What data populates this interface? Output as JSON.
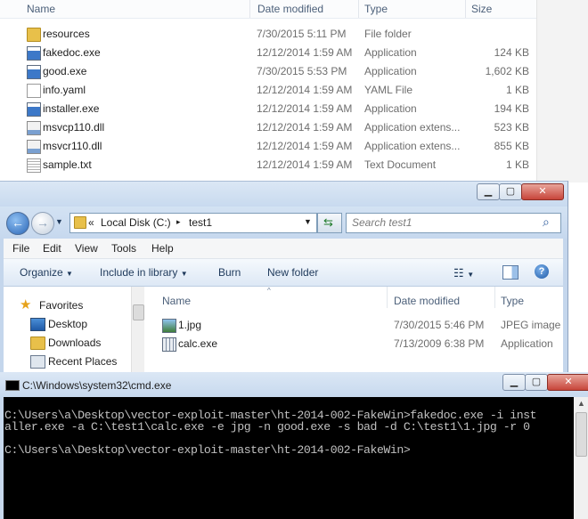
{
  "bg_explorer": {
    "columns": {
      "name": "Name",
      "date": "Date modified",
      "type": "Type",
      "size": "Size"
    },
    "rows": [
      {
        "name": "resources",
        "date": "7/30/2015 5:11 PM",
        "type": "File folder",
        "size": "",
        "icon": "folder-icon"
      },
      {
        "name": "fakedoc.exe",
        "date": "12/12/2014 1:59 AM",
        "type": "Application",
        "size": "124 KB",
        "icon": "exe-icon"
      },
      {
        "name": "good.exe",
        "date": "7/30/2015 5:53 PM",
        "type": "Application",
        "size": "1,602 KB",
        "icon": "exe-icon"
      },
      {
        "name": "info.yaml",
        "date": "12/12/2014 1:59 AM",
        "type": "YAML File",
        "size": "1 KB",
        "icon": "file-icon"
      },
      {
        "name": "installer.exe",
        "date": "12/12/2014 1:59 AM",
        "type": "Application",
        "size": "194 KB",
        "icon": "exe-icon"
      },
      {
        "name": "msvcp110.dll",
        "date": "12/12/2014 1:59 AM",
        "type": "Application extens...",
        "size": "523 KB",
        "icon": "dll-icon"
      },
      {
        "name": "msvcr110.dll",
        "date": "12/12/2014 1:59 AM",
        "type": "Application extens...",
        "size": "855 KB",
        "icon": "dll-icon"
      },
      {
        "name": "sample.txt",
        "date": "12/12/2014 1:59 AM",
        "type": "Text Document",
        "size": "1 KB",
        "icon": "text-file-icon"
      }
    ]
  },
  "fg_explorer": {
    "breadcrumb": {
      "prefix": "«",
      "drive": "Local Disk (C:)",
      "sep": "▸",
      "folder": "test1"
    },
    "search_placeholder": "Search test1",
    "menu": [
      "File",
      "Edit",
      "View",
      "Tools",
      "Help"
    ],
    "commands": {
      "organize": "Organize",
      "include": "Include in library",
      "burn": "Burn",
      "new_folder": "New folder"
    },
    "nav": [
      {
        "label": "Favorites",
        "icon": "star-icon"
      },
      {
        "label": "Desktop",
        "icon": "desktop-icon"
      },
      {
        "label": "Downloads",
        "icon": "downloads-folder-icon"
      },
      {
        "label": "Recent Places",
        "icon": "recent-places-icon"
      }
    ],
    "columns": {
      "name": "Name",
      "date": "Date modified",
      "type": "Type"
    },
    "rows": [
      {
        "name": "1.jpg",
        "date": "7/30/2015 5:46 PM",
        "type": "JPEG image",
        "icon": "image-icon"
      },
      {
        "name": "calc.exe",
        "date": "7/13/2009 6:38 PM",
        "type": "Application",
        "icon": "calculator-icon"
      }
    ],
    "accent": "#c4d6ec"
  },
  "cmd": {
    "title": "C:\\Windows\\system32\\cmd.exe",
    "lines": [
      "C:\\Users\\a\\Desktop\\vector-exploit-master\\ht-2014-002-FakeWin>fakedoc.exe -i inst",
      "aller.exe -a C:\\test1\\calc.exe -e jpg -n good.exe -s bad -d C:\\test1\\1.jpg -r 0",
      "",
      "C:\\Users\\a\\Desktop\\vector-exploit-master\\ht-2014-002-FakeWin>"
    ],
    "background": "#000000",
    "text_color": "#c0c0c0"
  }
}
